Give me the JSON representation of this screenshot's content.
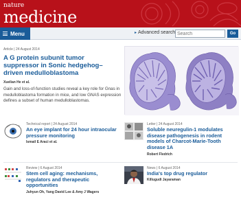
{
  "masthead": {
    "brand_small": "nature",
    "brand_big": "medicine"
  },
  "nav": {
    "menu_label": "Menu",
    "advanced_search": "Advanced search",
    "search_placeholder": "Search",
    "go_label": "Go"
  },
  "feature": {
    "meta": "Article | 24 August 2014",
    "title": "A G protein subunit tumor suppressor in Sonic hedgehog–driven medulloblastoma",
    "authors": "Xuelian He et al.",
    "abstract": "Gain and loss-of-function studies reveal a key role for Gnas in medulloblastoma formation in mice, and low GNAS expression defines a subset of human medulloblastomas."
  },
  "articles": [
    {
      "meta": "Technical report | 24 August 2014",
      "title": "An eye implant for 24 hour intraocular pressure monitoring",
      "authors": "Ismail E Araci et al."
    },
    {
      "meta": "Letter | 24 August 2014",
      "title": "Soluble neuregulin-1 modulates disease pathogenesis in rodent models of Charcot-Marie-Tooth disease 1A",
      "authors": "Robert Fledrich"
    },
    {
      "meta": "Review | 6 August 2014",
      "title": "Stem cell aging: mechanisms, regulators and therapeutic opportunities",
      "authors": "Juhyun Oh, Yang David Lee & Amy J Wagers"
    },
    {
      "meta": "News | 6 August 2014",
      "title": "India's top drug regulator",
      "authors": "Killugudi Jayaraman"
    }
  ],
  "colors": {
    "brand_red": "#b8111a",
    "link_blue": "#1a5c99",
    "tissue_purple": "#8e80c4"
  }
}
